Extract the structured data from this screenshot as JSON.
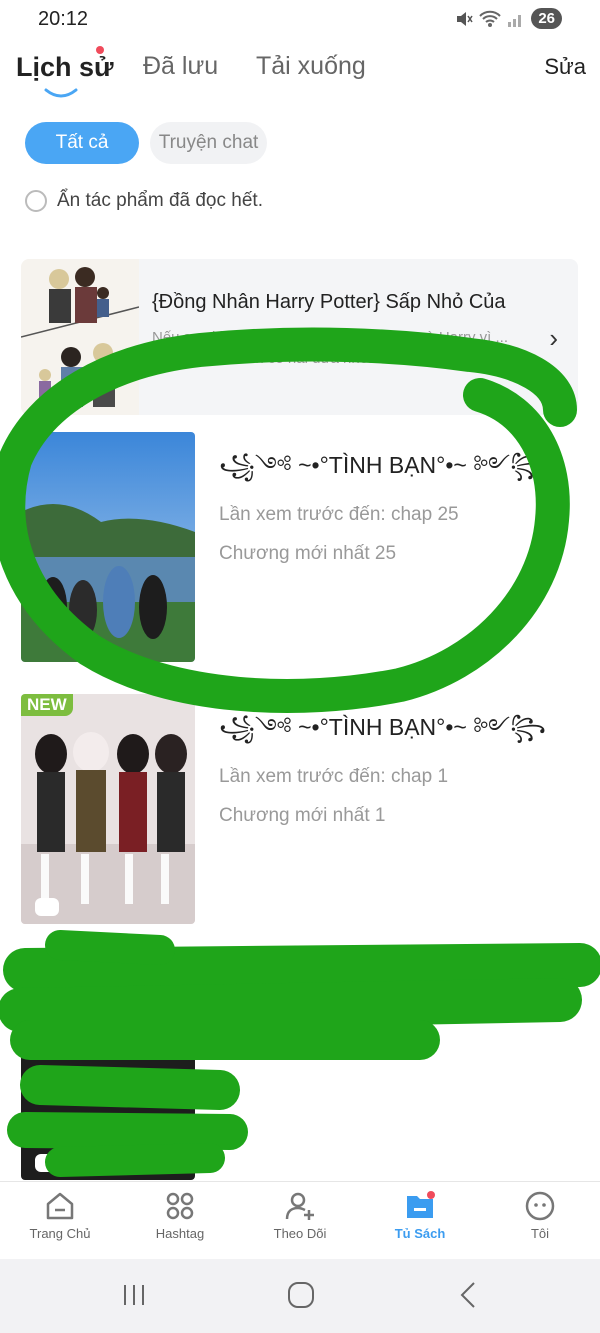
{
  "status_bar": {
    "time": "20:12",
    "battery": "26"
  },
  "header": {
    "tabs": [
      {
        "label": "Lịch sử",
        "active": true
      },
      {
        "label": "Đã lưu",
        "active": false
      },
      {
        "label": "Tải xuống",
        "active": false
      }
    ],
    "edit_label": "Sửa"
  },
  "filters": {
    "all": "Tất cả",
    "chat": "Truyện chat"
  },
  "hide_read_label": "Ẩn tác phẩm đã đọc hết.",
  "featured": {
    "title": "{Đồng Nhân Harry Potter} Sấp Nhỏ Của",
    "description": "Nếu sau khi chiến tranh kết thúc, Draco và Harry vì ... hôn nhân, ... con có hai đứa nhỏ...."
  },
  "entries": [
    {
      "title": "꧁༺ ~•°TÌNH BẠN°•~ ༻꧂",
      "last_read": "Lần xem trước đến: chap 25",
      "latest": "Chương mới nhất 25",
      "badge": ""
    },
    {
      "title": "꧁༺ ~•°TÌNH BẠN°•~ ༻꧂",
      "last_read": "Lần xem trước đến: chap 1",
      "latest": "Chương mới nhất 1",
      "badge": "NEW"
    }
  ],
  "bottom_nav": [
    {
      "label": "Trang Chủ",
      "icon": "home-icon"
    },
    {
      "label": "Hashtag",
      "icon": "grid-icon"
    },
    {
      "label": "Theo Dõi",
      "icon": "user-plus-icon"
    },
    {
      "label": "Tủ Sách",
      "icon": "bookshelf-icon",
      "active": true
    },
    {
      "label": "Tôi",
      "icon": "face-icon"
    }
  ],
  "colors": {
    "accent": "#4aa6f4",
    "active_nav": "#3b9cf0",
    "badge_green": "#7dbd3f",
    "notify_red": "#f04b5b",
    "marker_green": "#1fa51a"
  }
}
